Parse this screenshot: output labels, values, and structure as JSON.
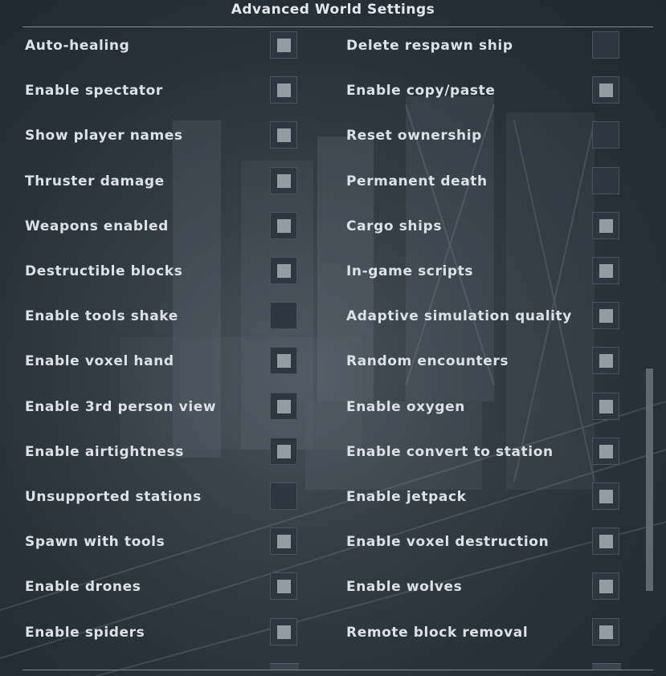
{
  "title": "Advanced World Settings",
  "left_column": [
    {
      "label": "Auto-healing",
      "checked": true
    },
    {
      "label": "Enable spectator",
      "checked": true
    },
    {
      "label": "Show player names",
      "checked": true
    },
    {
      "label": "Thruster damage",
      "checked": true
    },
    {
      "label": "Weapons enabled",
      "checked": true
    },
    {
      "label": "Destructible blocks",
      "checked": true
    },
    {
      "label": "Enable tools shake",
      "checked": false
    },
    {
      "label": "Enable voxel hand",
      "checked": true
    },
    {
      "label": "Enable 3rd person view",
      "checked": true
    },
    {
      "label": "Enable airtightness",
      "checked": true
    },
    {
      "label": "Unsupported stations",
      "checked": false
    },
    {
      "label": "Spawn with tools",
      "checked": true
    },
    {
      "label": "Enable drones",
      "checked": true
    },
    {
      "label": "Enable spiders",
      "checked": true
    }
  ],
  "right_column": [
    {
      "label": "Delete respawn ship",
      "checked": false
    },
    {
      "label": "Enable copy/paste",
      "checked": true
    },
    {
      "label": "Reset ownership",
      "checked": false
    },
    {
      "label": "Permanent death",
      "checked": false
    },
    {
      "label": "Cargo ships",
      "checked": true
    },
    {
      "label": "In-game scripts",
      "checked": true
    },
    {
      "label": "Adaptive simulation quality",
      "checked": true
    },
    {
      "label": "Random encounters",
      "checked": true
    },
    {
      "label": "Enable oxygen",
      "checked": true
    },
    {
      "label": "Enable convert to station",
      "checked": true
    },
    {
      "label": "Enable jetpack",
      "checked": true
    },
    {
      "label": "Enable voxel destruction",
      "checked": true
    },
    {
      "label": "Enable wolves",
      "checked": true
    },
    {
      "label": "Remote block removal",
      "checked": true
    }
  ],
  "colors": {
    "checkbox_bg": "#2c373f",
    "check_mark": "#939ca1",
    "text": "#dbe1e4",
    "scrollbar_thumb": "#5d6a72"
  },
  "scrollbar": {
    "position_fraction": 0.53,
    "visible_fraction": 0.35
  }
}
